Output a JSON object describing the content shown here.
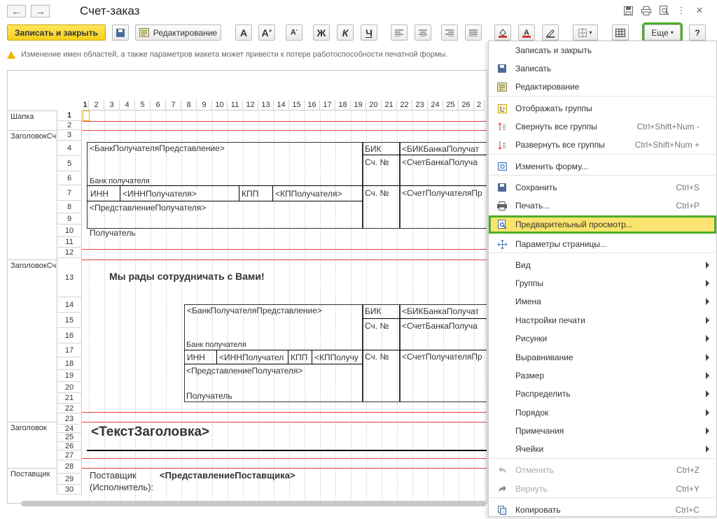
{
  "window": {
    "title": "Счет-заказ",
    "back_glyph": "←",
    "forward_glyph": "→",
    "controls": [
      "save-icon",
      "print-icon",
      "preview-icon",
      "more-icon",
      "close-icon"
    ],
    "close_glyph": "×",
    "more_glyph": "⋮"
  },
  "toolbar": {
    "save_close_label": "Записать и закрыть",
    "edit_label": "Редактирование",
    "bold_glyph": "Ж",
    "italic_glyph": "К",
    "underline_glyph": "Ч",
    "more_label": "Еще",
    "help_label": "?",
    "accent_color": "#f7cf1d",
    "highlight_color": "#4caf2a"
  },
  "warning": {
    "text": "Изменение имен областей, а также параметров макета может привести к потере работоспособности печатной формы."
  },
  "sheet": {
    "columns": [
      "1",
      "2",
      "3",
      "4",
      "5",
      "6",
      "7",
      "8",
      "9",
      "10",
      "11",
      "12",
      "13",
      "14",
      "15",
      "16",
      "17",
      "18",
      "19",
      "20",
      "21",
      "22",
      "23",
      "24",
      "25",
      "26",
      "2"
    ],
    "rows": [
      "1",
      "2",
      "3",
      "4",
      "5",
      "6",
      "7",
      "8",
      "9",
      "10",
      "11",
      "12",
      "13",
      "14",
      "15",
      "16",
      "17",
      "18",
      "19",
      "20",
      "21",
      "22",
      "23",
      "24",
      "25",
      "26",
      "27",
      "28",
      "29",
      "30"
    ],
    "areas": [
      "Шапка",
      "ЗаголовокСч",
      "ЗаголовокСч",
      "Заголовок",
      "Поставщик"
    ],
    "cells": {
      "bank_repr_1": "<БанкПолучателяПредставление>",
      "bik_1": "БИК",
      "bik_param_1": "<БИКБанкаПолучат",
      "acc_no_1": "Сч. №",
      "bank_acc_1": "<СчетБанкаПолуча",
      "bank_label_1": "Банк получателя",
      "inn_1": "ИНН",
      "inn_param_1": "<ИННПолучателя>",
      "kpp_1": "КПП",
      "kpp_param_1": "<КППолучателя>",
      "acc_no_2": "Сч. №",
      "recv_acc_1": "<СчетПолучателяПр",
      "recv_repr_1": "<ПредставлениеПолучателя>",
      "recv_label_1": "Получатель",
      "welcome": "Мы рады сотрудничать с Вами!",
      "bank_repr_2": "<БанкПолучателяПредставление>",
      "bik_2": "БИК",
      "bik_param_2": "<БИКБанкаПолучат",
      "acc_no_3": "Сч. №",
      "bank_acc_2": "<СчетБанкаПолуча",
      "bank_label_2": "Банк получателя",
      "inn_2": "ИНН",
      "inn_param_2": "<ИННПолучател",
      "kpp_2": "КПП",
      "kpp_param_2": "<КППолучу",
      "acc_no_4": "Сч. №",
      "recv_acc_2": "<СчетПолучателяПр",
      "recv_repr_2": "<ПредставлениеПолучателя>",
      "recv_label_2": "Получатель",
      "header_text": "<ТекстЗаголовка>",
      "supplier_label_1": "Поставщик",
      "supplier_label_2": "(Исполнитель):",
      "supplier_repr": "<ПредставлениеПоставщика>"
    }
  },
  "menu": {
    "items": [
      {
        "label": "Записать и закрыть",
        "icon": "none",
        "shortcut": ""
      },
      {
        "label": "Записать",
        "icon": "save-icon",
        "shortcut": ""
      },
      {
        "label": "Редактирование",
        "icon": "edit-icon",
        "shortcut": ""
      },
      {
        "label": "Отображать группы",
        "icon": "groups-icon",
        "shortcut": ""
      },
      {
        "label": "Свернуть все группы",
        "icon": "collapse-icon",
        "shortcut": "Ctrl+Shift+Num -"
      },
      {
        "label": "Развернуть все группы",
        "icon": "expand-icon",
        "shortcut": "Ctrl+Shift+Num +"
      },
      {
        "label": "Изменить форму...",
        "icon": "form-icon",
        "shortcut": ""
      },
      {
        "label": "Сохранить",
        "icon": "save-icon",
        "shortcut": "Ctrl+S"
      },
      {
        "label": "Печать...",
        "icon": "print-icon",
        "shortcut": "Ctrl+P"
      },
      {
        "label": "Предварительный просмотр...",
        "icon": "preview-icon",
        "shortcut": ""
      },
      {
        "label": "Параметры страницы...",
        "icon": "page-settings-icon",
        "shortcut": ""
      },
      {
        "label": "Вид",
        "icon": "none",
        "shortcut": ""
      },
      {
        "label": "Группы",
        "icon": "none",
        "shortcut": ""
      },
      {
        "label": "Имена",
        "icon": "none",
        "shortcut": ""
      },
      {
        "label": "Настройки печати",
        "icon": "none",
        "shortcut": ""
      },
      {
        "label": "Рисунки",
        "icon": "none",
        "shortcut": ""
      },
      {
        "label": "Выравнивание",
        "icon": "none",
        "shortcut": ""
      },
      {
        "label": "Размер",
        "icon": "none",
        "shortcut": ""
      },
      {
        "label": "Распределить",
        "icon": "none",
        "shortcut": ""
      },
      {
        "label": "Порядок",
        "icon": "none",
        "shortcut": ""
      },
      {
        "label": "Примечания",
        "icon": "none",
        "shortcut": ""
      },
      {
        "label": "Ячейки",
        "icon": "none",
        "shortcut": ""
      },
      {
        "label": "Отменить",
        "icon": "undo-icon",
        "shortcut": "Ctrl+Z"
      },
      {
        "label": "Вернуть",
        "icon": "redo-icon",
        "shortcut": "Ctrl+Y"
      },
      {
        "label": "Копировать",
        "icon": "copy-icon",
        "shortcut": "Ctrl+C"
      }
    ]
  }
}
